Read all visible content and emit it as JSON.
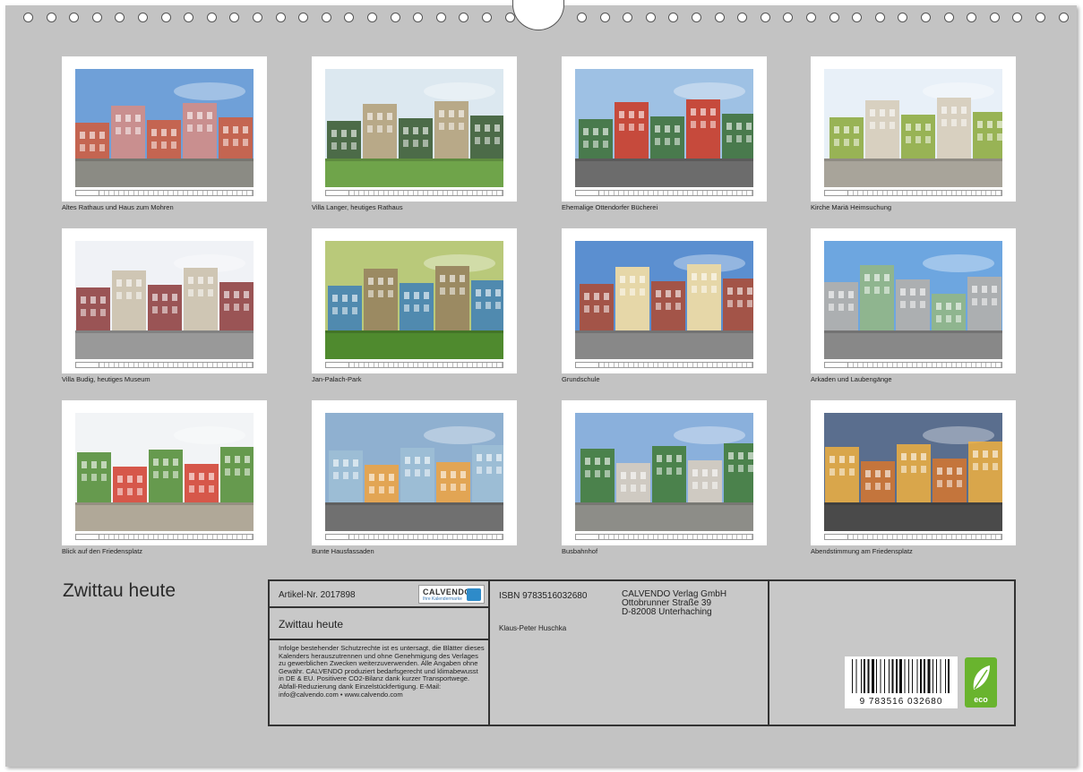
{
  "tiles": [
    {
      "caption": "Altes Rathaus und Haus zum Mohren",
      "sky": "#6fa0d8",
      "ground": "#8b8b84",
      "wall": "#c98f8f",
      "accent": "#d45b3a"
    },
    {
      "caption": "Villa Langer, heutiges Rathaus",
      "sky": "#dce8f0",
      "ground": "#6fa44a",
      "wall": "#b8a988",
      "accent": "#33552a"
    },
    {
      "caption": "Ehemalige Ottendorfer Bücherei",
      "sky": "#9ec1e4",
      "ground": "#6c6c6c",
      "wall": "#c64a3c",
      "accent": "#3a6d32"
    },
    {
      "caption": "Kirche Mariä Heimsuchung",
      "sky": "#e8f0f8",
      "ground": "#a8a49a",
      "wall": "#d8d0c0",
      "accent": "#8aa838"
    },
    {
      "caption": "Villa Budig, heutiges Museum",
      "sky": "#f0f2f6",
      "ground": "#999",
      "wall": "#cfc6b4",
      "accent": "#8b3838"
    },
    {
      "caption": "Jan-Palach-Park",
      "sky": "#b9c97a",
      "ground": "#4f8a2e",
      "wall": "#9b8a62",
      "accent": "#3d7fb8"
    },
    {
      "caption": "Grundschule",
      "sky": "#5b8fd0",
      "ground": "#888",
      "wall": "#e6d7a8",
      "accent": "#b04a30"
    },
    {
      "caption": "Arkaden und Laubengänge",
      "sky": "#6da6e0",
      "ground": "#888",
      "wall": "#8fb58f",
      "accent": "#b7b0a8"
    },
    {
      "caption": "Blick auf den Friedensplatz",
      "sky": "#f2f4f6",
      "ground": "#b0a898",
      "wall": "#d6574a",
      "accent": "#4e8a30"
    },
    {
      "caption": "Bunte Hausfassaden",
      "sky": "#8fb0d0",
      "ground": "#707070",
      "wall": "#e2a554",
      "accent": "#9fc0d6"
    },
    {
      "caption": "Busbahnhof",
      "sky": "#8ab0dc",
      "ground": "#8d8d88",
      "wall": "#cfcac2",
      "accent": "#3f7a32"
    },
    {
      "caption": "Abendstimmung am Friedensplatz",
      "sky": "#5a6e8e",
      "ground": "#4a4a4a",
      "wall": "#c4753c",
      "accent": "#f0b040"
    }
  ],
  "title": "Zwittau heute",
  "info": {
    "article": "Artikel-Nr. 2017898",
    "logo_name": "CALVENDO",
    "logo_sub": "Ihre Kalendermarke",
    "subtitle": "Zwittau heute",
    "legal": "Infolge bestehender Schutzrechte ist es untersagt, die Blätter dieses Kalenders herauszutrennen und ohne Genehmigung des Verlages zu gewerblichen Zwecken weiterzuverwenden. Alle Angaben ohne Gewähr. CALVENDO produziert bedarfsgerecht und klimabewusst in DE & EU. Positivere CO2-Bilanz dank kurzer Transportwege. Abfall-Reduzierung dank Einzelstückfertigung. E-Mail: info@calvendo.com • www.calvendo.com",
    "isbn": "ISBN 9783516032680",
    "publisher_name": "CALVENDO Verlag GmbH",
    "publisher_street": "Ottobrunner Straße 39",
    "publisher_city": "D-82008 Unterhaching",
    "author": "Klaus-Peter Huschka",
    "barcode_number": "9 783516 032680",
    "eco_label": "eco"
  }
}
